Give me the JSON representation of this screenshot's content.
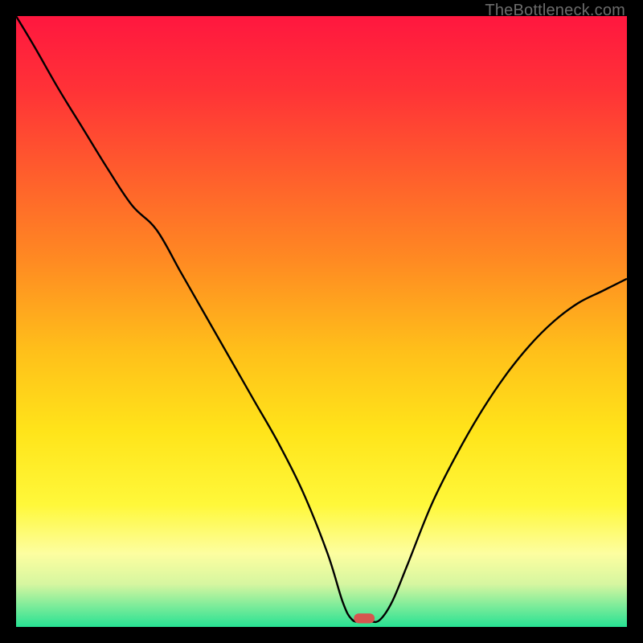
{
  "attribution": "TheBottleneck.com",
  "chart_data": {
    "type": "line",
    "title": "",
    "xlabel": "",
    "ylabel": "",
    "xlim": [
      0,
      100
    ],
    "ylim": [
      0,
      100
    ],
    "background": {
      "type": "vertical-gradient",
      "stops": [
        {
          "offset": 0.0,
          "color": "#ff173f"
        },
        {
          "offset": 0.12,
          "color": "#ff3237"
        },
        {
          "offset": 0.25,
          "color": "#ff5b2d"
        },
        {
          "offset": 0.4,
          "color": "#ff8a22"
        },
        {
          "offset": 0.55,
          "color": "#ffc01a"
        },
        {
          "offset": 0.68,
          "color": "#ffe41a"
        },
        {
          "offset": 0.8,
          "color": "#fff83a"
        },
        {
          "offset": 0.88,
          "color": "#fdfea0"
        },
        {
          "offset": 0.93,
          "color": "#d6f6a0"
        },
        {
          "offset": 0.965,
          "color": "#7eec9a"
        },
        {
          "offset": 1.0,
          "color": "#27e293"
        }
      ]
    },
    "series": [
      {
        "name": "bottleneck-curve",
        "color": "#000000",
        "stroke_width": 2.4,
        "x": [
          0.0,
          3.0,
          7.0,
          11.0,
          15.0,
          19.0,
          23.0,
          27.0,
          31.0,
          35.0,
          39.0,
          43.0,
          47.0,
          51.0,
          53.5,
          55.0,
          56.5,
          58.0,
          59.5,
          61.5,
          64.0,
          68.0,
          72.0,
          76.0,
          80.0,
          84.0,
          88.0,
          92.0,
          96.0,
          100.0
        ],
        "y": [
          100.0,
          95.0,
          88.0,
          81.5,
          75.0,
          69.0,
          65.0,
          58.0,
          51.0,
          44.0,
          37.0,
          30.0,
          22.0,
          12.0,
          4.0,
          1.2,
          0.9,
          0.9,
          1.1,
          4.0,
          10.0,
          20.0,
          28.0,
          35.0,
          41.0,
          46.0,
          50.0,
          53.0,
          55.0,
          57.0
        ]
      }
    ],
    "marker": {
      "type": "rounded-rect",
      "x": 57.0,
      "y": 1.4,
      "width": 3.4,
      "height": 1.6,
      "rx": 0.8,
      "fill": "#d6564f"
    }
  }
}
